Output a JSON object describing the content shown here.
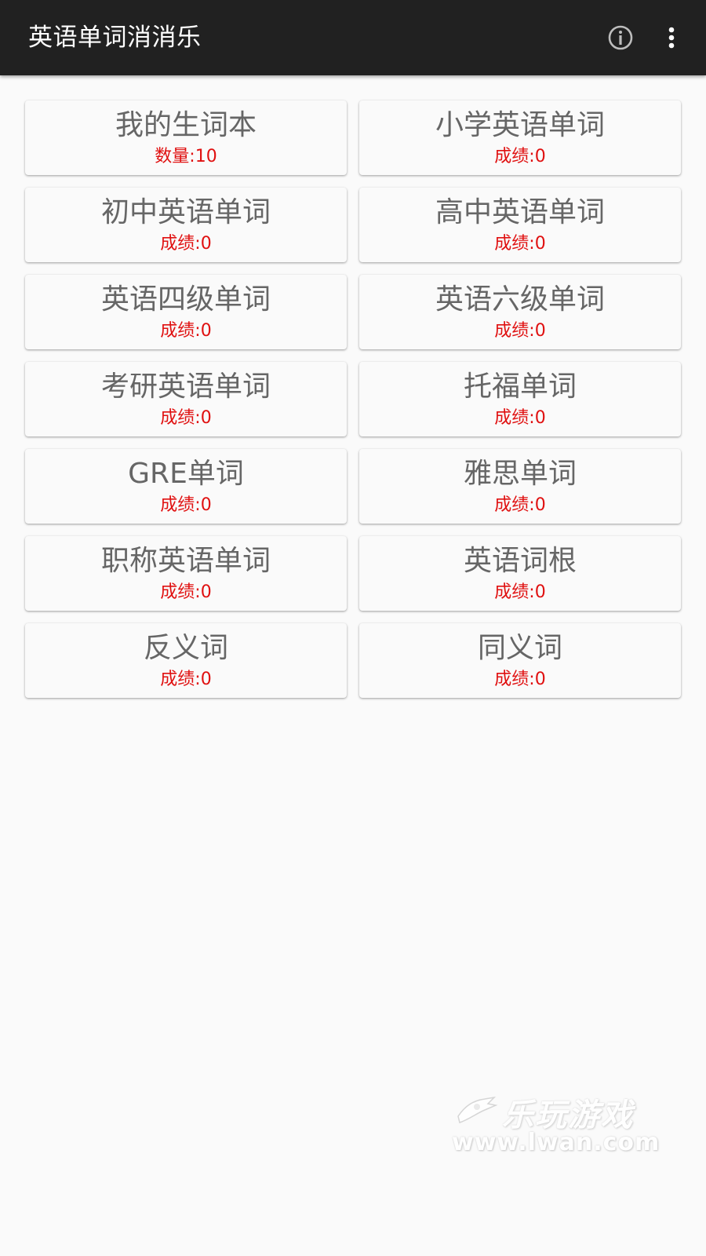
{
  "app_bar": {
    "title": "英语单词消消乐",
    "info_icon": "info-icon",
    "more_icon": "more-vert-icon"
  },
  "cards": [
    {
      "title": "我的生词本",
      "score": "数量:10"
    },
    {
      "title": "小学英语单词",
      "score": "成绩:0"
    },
    {
      "title": "初中英语单词",
      "score": "成绩:0"
    },
    {
      "title": "高中英语单词",
      "score": "成绩:0"
    },
    {
      "title": "英语四级单词",
      "score": "成绩:0"
    },
    {
      "title": "英语六级单词",
      "score": "成绩:0"
    },
    {
      "title": "考研英语单词",
      "score": "成绩:0"
    },
    {
      "title": "托福单词",
      "score": "成绩:0"
    },
    {
      "title": "GRE单词",
      "score": "成绩:0"
    },
    {
      "title": "雅思单词",
      "score": "成绩:0"
    },
    {
      "title": "职称英语单词",
      "score": "成绩:0"
    },
    {
      "title": "英语词根",
      "score": "成绩:0"
    },
    {
      "title": "反义词",
      "score": "成绩:0"
    },
    {
      "title": "同义词",
      "score": "成绩:0"
    }
  ],
  "watermark": {
    "brand": "乐玩游戏",
    "url": "www.lwan.com"
  },
  "colors": {
    "app_bar": "#212121",
    "background": "#fafafa",
    "card_title": "#666666",
    "score": "#e01010"
  }
}
